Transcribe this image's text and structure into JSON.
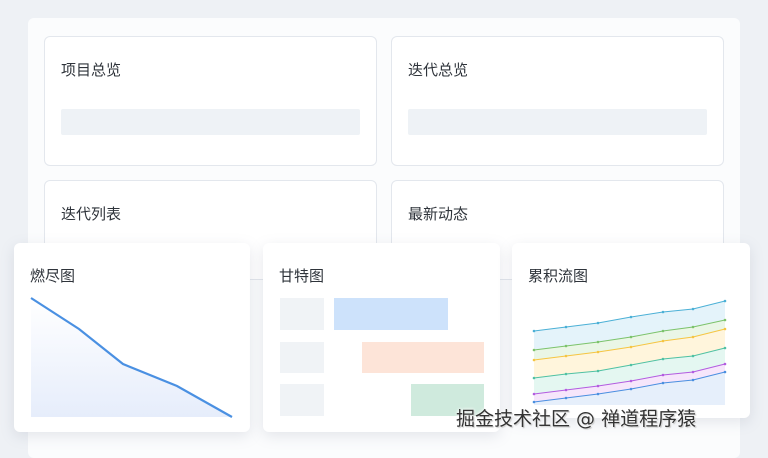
{
  "cards": {
    "project_overview": "项目总览",
    "iteration_overview": "迭代总览",
    "iteration_list": "迭代列表",
    "latest_activity": "最新动态"
  },
  "charts": {
    "burndown": "燃尽图",
    "gantt": "甘特图",
    "cumulative_flow": "累积流图"
  },
  "watermark": "掘金技术社区 @ 禅道程序猿",
  "colors": {
    "burndown_line": "#4a90e2",
    "gantt": [
      "#cde2fb",
      "#fde4d8",
      "#cfeadd"
    ],
    "cfd": [
      "#4bb0d6",
      "#7cc36b",
      "#f5c542",
      "#4fc1a3",
      "#b35ce0",
      "#4a8fe0"
    ]
  }
}
